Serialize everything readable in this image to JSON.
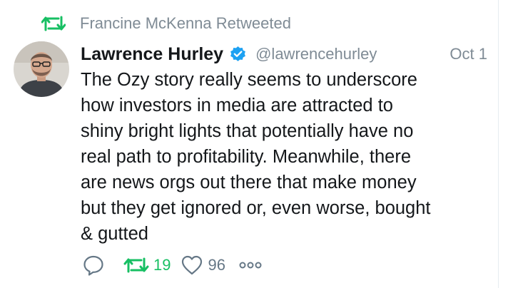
{
  "retweet_context": {
    "icon": "retweet-icon",
    "text": "Francine McKenna Retweeted"
  },
  "author": {
    "display_name": "Lawrence Hurley",
    "verified_icon": "verified-badge-icon",
    "handle": "@lawrencehurley",
    "timestamp": "Oct 1"
  },
  "tweet": {
    "text": "The Ozy story really seems to underscore\nhow investors in media are attracted to\nshiny bright lights that potentially have no\nreal path to profitability. Meanwhile, there\nare news orgs out there that make money\nbut they get ignored or, even worse, bought\n& gutted"
  },
  "actions": {
    "reply": {
      "icon": "reply-icon"
    },
    "retweet": {
      "icon": "retweet-icon",
      "count": "19",
      "active": true
    },
    "like": {
      "icon": "heart-icon",
      "count": "96"
    },
    "more": {
      "icon": "more-dots-icon"
    }
  },
  "colors": {
    "retweet_green": "#17bf63",
    "verified_blue": "#1da1f2",
    "muted_gray": "#7f8b95",
    "text": "#14171a"
  }
}
